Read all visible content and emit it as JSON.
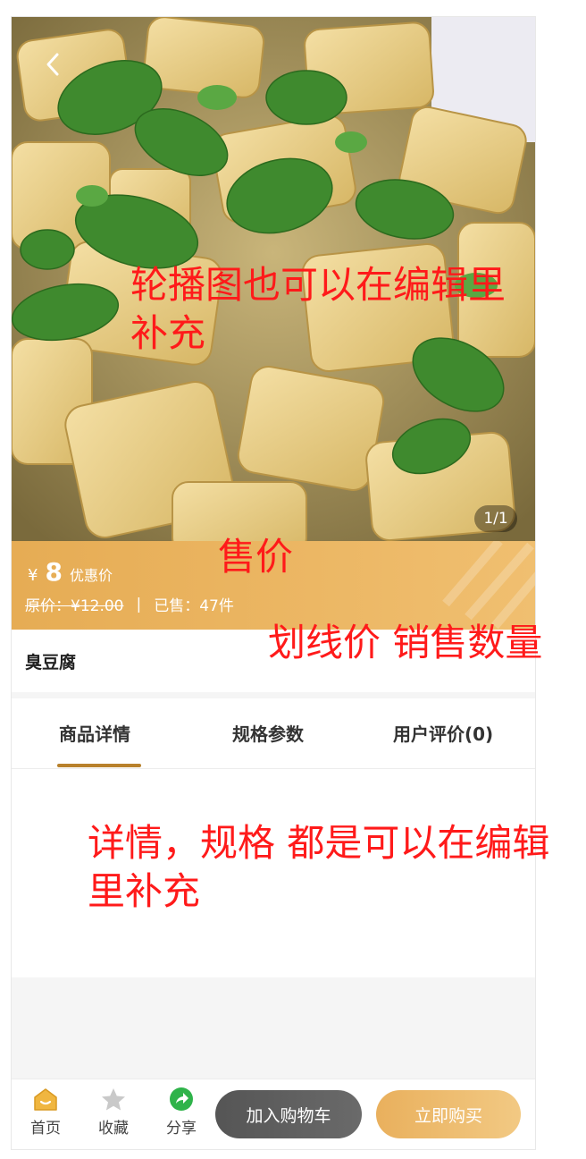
{
  "carousel": {
    "indicator": "1/1"
  },
  "price": {
    "currency": "¥",
    "value": "8",
    "tag": "优惠价"
  },
  "sale": {
    "original": "原价：¥12.00",
    "divider": "|",
    "sold": "已售：47件"
  },
  "goods": {
    "name": "臭豆腐"
  },
  "tabs": [
    {
      "label": "商品详情",
      "active": true
    },
    {
      "label": "规格参数",
      "active": false
    },
    {
      "label": "用户评价(0)",
      "active": false
    }
  ],
  "bottom_nav": {
    "home": "首页",
    "favorite": "收藏",
    "share": "分享",
    "add_cart": "加入购物车",
    "buy_now": "立即购买"
  },
  "annotations": {
    "carousel": "轮播图也可以在编辑里补充",
    "price": "售价",
    "strike_sales": "划线价 销售数量",
    "detail": "详情，规格 都是可以在编辑里补充"
  },
  "colors": {
    "accent_gold": "#e8ae5a",
    "tab_underline": "#b8812c",
    "annotation_red": "#ff1a1a",
    "cart_button": "#5a5a5a"
  }
}
